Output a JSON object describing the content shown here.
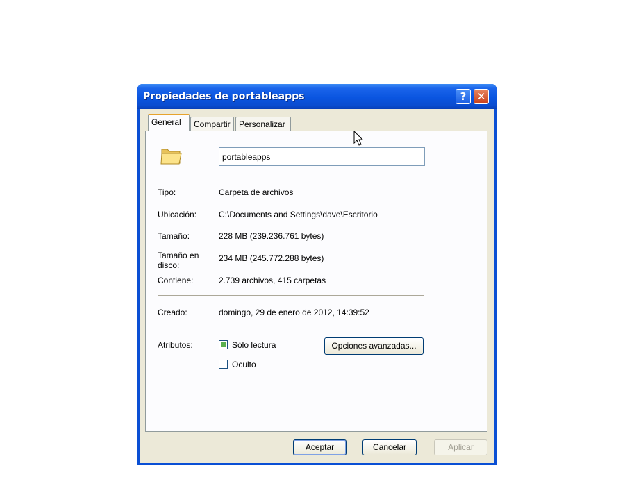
{
  "window": {
    "title": "Propiedades de portableapps",
    "help_label": "?",
    "close_label": "✕"
  },
  "tabs": [
    {
      "label": "General"
    },
    {
      "label": "Compartir"
    },
    {
      "label": "Personalizar"
    }
  ],
  "general": {
    "folder_name": "portableapps",
    "rows": {
      "tipo": {
        "label": "Tipo:",
        "value": "Carpeta de archivos"
      },
      "ubicacion": {
        "label": "Ubicación:",
        "value": "C:\\Documents and Settings\\dave\\Escritorio"
      },
      "tamano": {
        "label": "Tamaño:",
        "value": "228 MB (239.236.761 bytes)"
      },
      "tamano_disco": {
        "label": "Tamaño en disco:",
        "value": "234 MB (245.772.288 bytes)"
      },
      "contiene": {
        "label": "Contiene:",
        "value": "2.739 archivos, 415 carpetas"
      },
      "creado": {
        "label": "Creado:",
        "value": "domingo, 29 de enero de 2012, 14:39:52"
      }
    },
    "attributes": {
      "label": "Atributos:",
      "read_only": {
        "label": "Sólo lectura",
        "state": "indeterminate"
      },
      "hidden": {
        "label": "Oculto",
        "state": "unchecked"
      },
      "advanced_button": "Opciones avanzadas..."
    }
  },
  "buttons": {
    "ok": "Aceptar",
    "cancel": "Cancelar",
    "apply": "Aplicar"
  },
  "icons": {
    "folder": "folder-icon",
    "cursor": "mouse-pointer-icon"
  },
  "colors": {
    "titlebar": "#0a55e0",
    "dialog_bg": "#ece9d8",
    "tab_highlight": "#e6a32e",
    "close_button": "#c9401b"
  }
}
